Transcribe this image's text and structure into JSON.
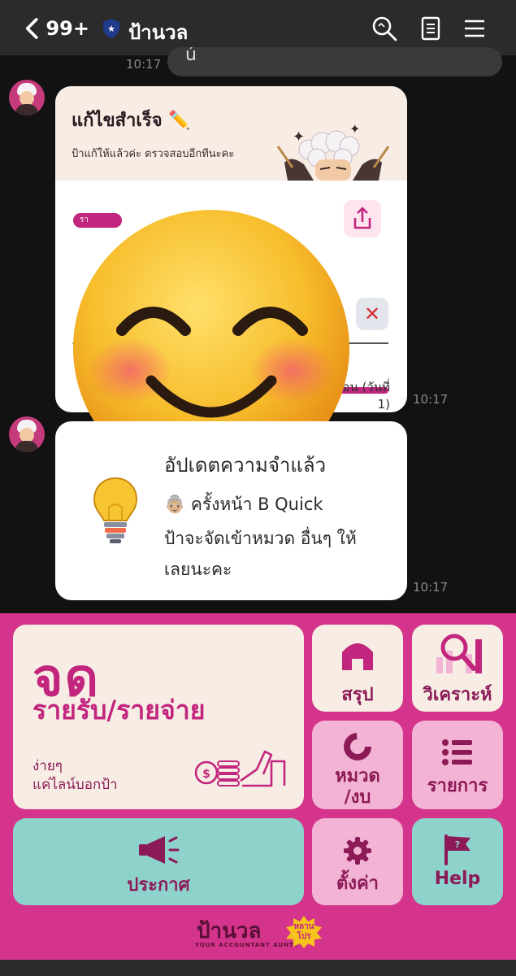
{
  "header": {
    "back_count": "99+",
    "title": "ป้านวล",
    "icons": [
      "chevron-left-icon",
      "shield-star-icon",
      "search-icon",
      "note-icon",
      "menu-icon"
    ]
  },
  "chat": {
    "partial_text": "ú",
    "messages": [
      {
        "time": "10:17",
        "title": "แก้ไขสำเร็จ ✏️",
        "subtitle": "ป้าแก้ให้แล้วค่ะ ตรวจสอบอีกทีนะคะ",
        "tag": "รา",
        "fragment": "อี",
        "footer": "ทุกเดือน (วันที่ 1)",
        "remove_symbol": "✕"
      },
      {
        "time": "10:17",
        "title": "อัปเดตความจำแล้ว",
        "line1": "👵🏼 ครั้งหน้า B Quick",
        "line2": "ป้าจะจัดเข้าหมวด อื่นๆ ให้",
        "line3": "เลยนะคะ"
      }
    ],
    "first_time": "10:17"
  },
  "menu": {
    "record": {
      "big": "จด",
      "sub": "รายรับ/รายจ่าย",
      "hint1": "ง่ายๆ",
      "hint2": "แค่ไลน์บอกป้า"
    },
    "summary_label": "สรุป",
    "analyze_label": "วิเคราะห์",
    "category_label1": "หมวด",
    "category_label2": "/งบ",
    "list_label": "รายการ",
    "announce_label": "ประกาศ",
    "settings_label": "ตั้งค่า",
    "help_label": "Help",
    "brand_name": "ป้านวล",
    "brand_tagline": "YOUR ACCOUNTANT AUNTY",
    "brand_badge": "หลานโปร"
  },
  "colors": {
    "menu_bg": "#d4348b",
    "tile_cream": "#f7ede4",
    "tile_pink": "#f3b3d4",
    "tile_teal": "#8ed3cb",
    "accent_dark": "#8c1a57"
  }
}
